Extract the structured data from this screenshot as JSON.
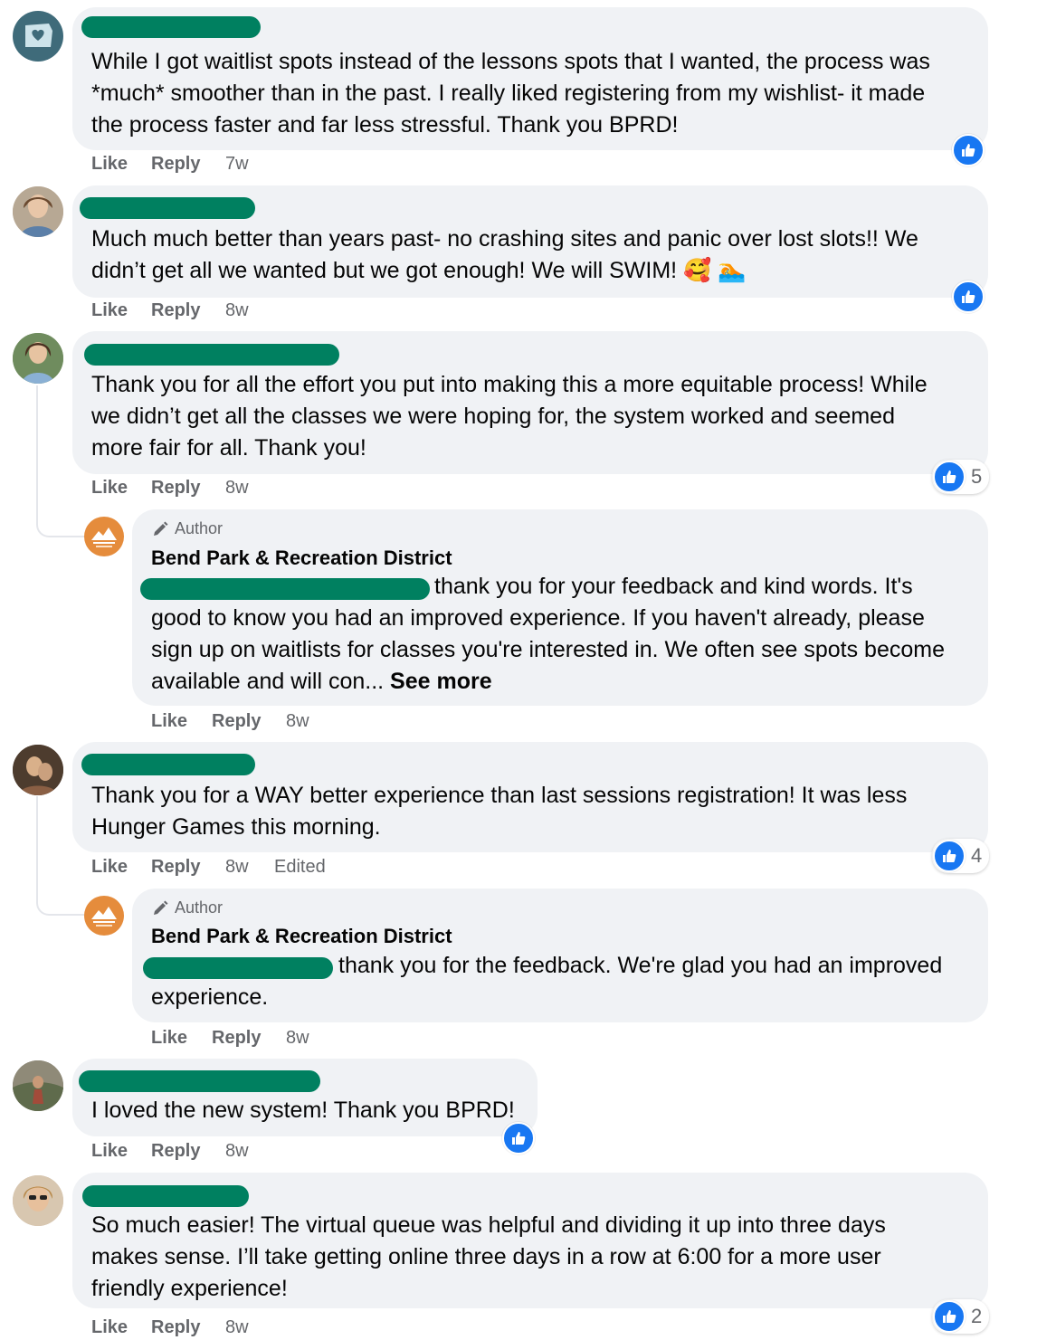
{
  "comments": [
    {
      "text_lines": [
        "While I got waitlist spots instead of the lessons spots that I wanted, the process was",
        "*much* smoother than in the past. I really liked registering from my wishlist- it made",
        "the process faster and far less stressful. Thank you BPRD!"
      ],
      "like": "Like",
      "reply": "Reply",
      "time": "7w"
    },
    {
      "text_lines": [
        "Much much better than years past- no crashing sites and panic over lost slots!! We",
        "didn’t get all we wanted but we got enough! We will SWIM! 🥰 🏊"
      ],
      "like": "Like",
      "reply": "Reply",
      "time": "8w"
    },
    {
      "text_lines": [
        "Thank you for all the effort you put into making this a more equitable process! While",
        "we didn’t get all the classes we were hoping for, the system worked and seemed",
        "more fair for all. Thank you!"
      ],
      "like": "Like",
      "reply": "Reply",
      "time": "8w",
      "reaction_count": "5"
    },
    {
      "text_lines": [
        "Thank you for a WAY better experience than last sessions registration! It was less",
        "Hunger Games this morning."
      ],
      "like": "Like",
      "reply": "Reply",
      "time": "8w",
      "edited": "Edited",
      "reaction_count": "4"
    },
    {
      "text_lines": [
        "I loved the new system! Thank you BPRD!"
      ],
      "like": "Like",
      "reply": "Reply",
      "time": "8w"
    },
    {
      "text_lines": [
        "So much easier! The virtual queue was helpful and dividing it up into three days",
        "makes sense. I’ll take getting online three days in a row at 6:00 for a more user",
        "friendly experience!"
      ],
      "like": "Like",
      "reply": "Reply",
      "time": "8w",
      "reaction_count": "2"
    }
  ],
  "replies": [
    {
      "author_tag": "Author",
      "author_name": "Bend Park & Recreation District",
      "line1": "thank you for your feedback and kind words. It's",
      "text_lines": [
        "good to know you had an improved experience. If you haven't already, please",
        "sign up on waitlists for classes you're interested in. We often see spots become"
      ],
      "last_line": "available and will con... ",
      "see_more": "See more",
      "like": "Like",
      "reply": "Reply",
      "time": "8w"
    },
    {
      "author_tag": "Author",
      "author_name": "Bend Park & Recreation District",
      "line1": "thank you for the feedback. We're glad you had an improved",
      "text_lines": [
        "experience."
      ],
      "like": "Like",
      "reply": "Reply",
      "time": "8w"
    }
  ],
  "colors": {
    "redaction": "#008060",
    "bubble": "#f0f2f5",
    "like_blue": "#1877f2",
    "brand_orange": "#e58c3c"
  }
}
